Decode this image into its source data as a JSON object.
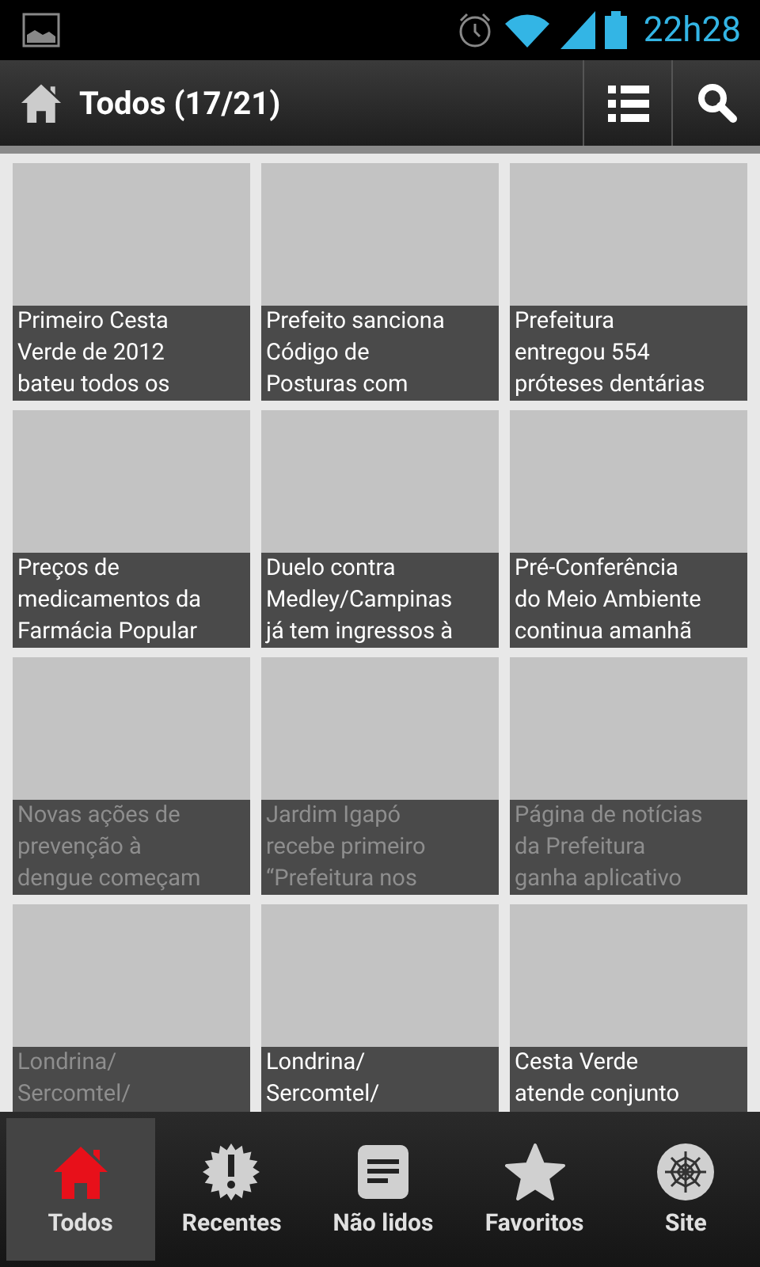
{
  "status_bar": {
    "time": "22h28"
  },
  "action_bar": {
    "title": "Todos (17/21)"
  },
  "items": [
    {
      "title": "Primeiro Cesta\nVerde de 2012\nbateu todos os",
      "read": false
    },
    {
      "title": "Prefeito sanciona\nCódigo de\nPosturas com",
      "read": false
    },
    {
      "title": "Prefeitura\nentregou 554\npróteses dentárias",
      "read": false
    },
    {
      "title": "Preços de\nmedicamentos da\nFarmácia Popular",
      "read": false
    },
    {
      "title": "Duelo contra\nMedley/Campinas\njá tem ingressos à",
      "read": false
    },
    {
      "title": "Pré-Conferência\ndo Meio Ambiente\ncontinua amanhã",
      "read": false
    },
    {
      "title": "Novas ações de\nprevenção à\ndengue começam",
      "read": true
    },
    {
      "title": "Jardim Igapó\nrecebe primeiro\n“Prefeitura nos",
      "read": true
    },
    {
      "title": "Página de notícias\nda Prefeitura\nganha aplicativo",
      "read": true
    },
    {
      "title": "Londrina/\nSercomtel/",
      "read": true
    },
    {
      "title": "Londrina/\nSercomtel/",
      "read": false
    },
    {
      "title": "Cesta Verde\natende conjunto",
      "read": false
    }
  ],
  "tabs": [
    {
      "label": "Todos",
      "kind": "home",
      "selected": true
    },
    {
      "label": "Recentes",
      "kind": "alert",
      "selected": false
    },
    {
      "label": "Não lidos",
      "kind": "note",
      "selected": false
    },
    {
      "label": "Favoritos",
      "kind": "star",
      "selected": false
    },
    {
      "label": "Site",
      "kind": "web",
      "selected": false
    }
  ]
}
